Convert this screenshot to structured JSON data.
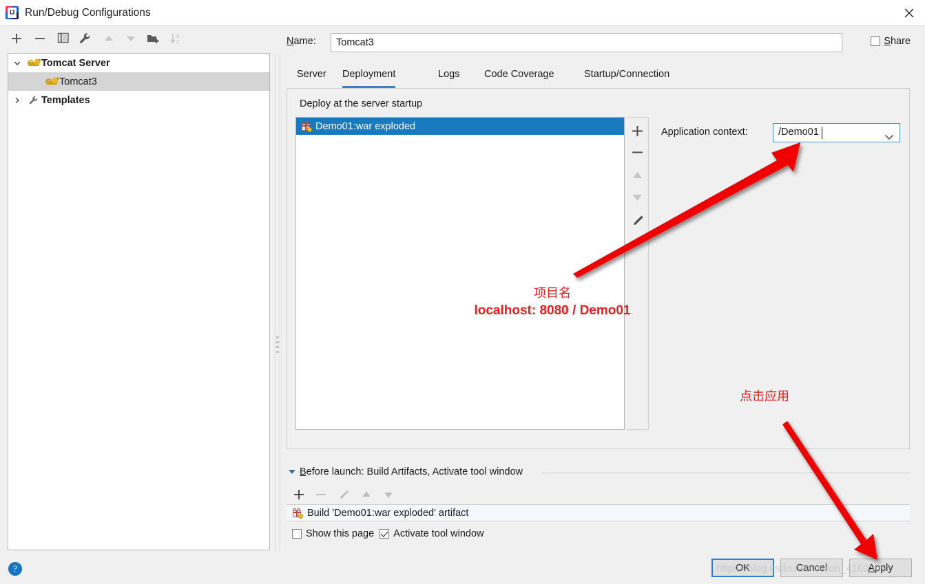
{
  "window": {
    "title": "Run/Debug Configurations",
    "app_icon": "intellij-idea-icon",
    "close_icon": "close-icon"
  },
  "left_toolbar": {
    "buttons": [
      {
        "name": "add-configuration-button",
        "icon": "plus-icon",
        "enabled": true
      },
      {
        "name": "remove-configuration-button",
        "icon": "minus-icon",
        "enabled": true
      },
      {
        "name": "copy-configuration-button",
        "icon": "copy-icon",
        "enabled": true
      },
      {
        "name": "edit-templates-button",
        "icon": "wrench-icon",
        "enabled": true
      },
      {
        "name": "move-up-button",
        "icon": "arrow-up-icon",
        "enabled": false
      },
      {
        "name": "move-down-button",
        "icon": "arrow-down-icon",
        "enabled": false
      },
      {
        "name": "create-folder-button",
        "icon": "folder-add-icon",
        "enabled": true
      },
      {
        "name": "sort-configurations-button",
        "icon": "sort-az-icon",
        "enabled": false
      }
    ]
  },
  "tree": {
    "items": [
      {
        "label": "Tomcat Server",
        "icon": "tomcat-icon",
        "expanded": true,
        "bold": true,
        "level": 0,
        "selected": false
      },
      {
        "label": "Tomcat3",
        "icon": "tomcat-icon",
        "expanded": null,
        "bold": false,
        "level": 1,
        "selected": true
      },
      {
        "label": "Templates",
        "icon": "wrench-icon",
        "expanded": false,
        "bold": true,
        "level": 0,
        "selected": false
      }
    ]
  },
  "name_row": {
    "label": "Name:",
    "label_mnemonic": "N",
    "value": "Tomcat3",
    "share_label": "Share",
    "share_mnemonic": "S",
    "share_checked": false
  },
  "tabs": [
    {
      "label": "Server",
      "active": false
    },
    {
      "label": "Deployment",
      "active": true
    },
    {
      "label": "Logs",
      "active": false
    },
    {
      "label": "Code Coverage",
      "active": false
    },
    {
      "label": "Startup/Connection",
      "active": false
    }
  ],
  "deployment": {
    "group_label": "Deploy at the server startup",
    "artifacts": [
      {
        "label": "Demo01:war exploded",
        "icon": "artifact-icon",
        "selected": true
      }
    ],
    "list_buttons": [
      {
        "name": "add-artifact-button",
        "icon": "plus-icon",
        "enabled": true
      },
      {
        "name": "remove-artifact-button",
        "icon": "minus-icon",
        "enabled": true
      },
      {
        "name": "move-artifact-up-button",
        "icon": "arrow-up-icon",
        "enabled": false
      },
      {
        "name": "move-artifact-down-button",
        "icon": "arrow-down-icon",
        "enabled": false
      },
      {
        "name": "edit-artifact-button",
        "icon": "pencil-icon",
        "enabled": true
      }
    ],
    "application_context_label": "Application context:",
    "application_context_value": "/Demo01",
    "application_context_dropdown_icon": "chevron-down-icon"
  },
  "annotations": [
    {
      "name": "project-name-annotation",
      "line1": "项目名",
      "line2": "localhost: 8080 / Demo01",
      "color": "#e81d1d"
    },
    {
      "name": "click-apply-annotation",
      "line1": "点击应用",
      "color": "#e81d1d"
    }
  ],
  "before_launch": {
    "header": "Before launch: Build Artifacts, Activate tool window",
    "header_mnemonic": "B",
    "expanded": true,
    "toolbar": [
      {
        "name": "add-task-button",
        "icon": "plus-icon",
        "enabled": true
      },
      {
        "name": "remove-task-button",
        "icon": "minus-icon",
        "enabled": false
      },
      {
        "name": "edit-task-button",
        "icon": "pencil-icon",
        "enabled": false
      },
      {
        "name": "task-move-up-button",
        "icon": "arrow-up-icon",
        "enabled": false
      },
      {
        "name": "task-move-down-button",
        "icon": "arrow-down-icon",
        "enabled": false
      }
    ],
    "tasks": [
      {
        "label": "Build 'Demo01:war exploded' artifact",
        "icon": "artifact-icon"
      }
    ],
    "checkboxes": [
      {
        "label": "Show this page",
        "checked": false
      },
      {
        "label": "Activate tool window",
        "checked": true
      }
    ]
  },
  "footer": {
    "help_icon": "help-icon",
    "help_glyph": "?",
    "ok_label": "OK",
    "cancel_label": "Cancel",
    "apply_label": "Apply",
    "apply_mnemonic": "A",
    "watermark": "https://blog.csdn.net/weixin_41023057"
  },
  "colors": {
    "selection_blue": "#1a7ac0",
    "accent_tab": "#3e7ec4",
    "annotation_red": "#e81d1d",
    "help_blue": "#1675c0",
    "window_bg": "#f0f0f0"
  }
}
